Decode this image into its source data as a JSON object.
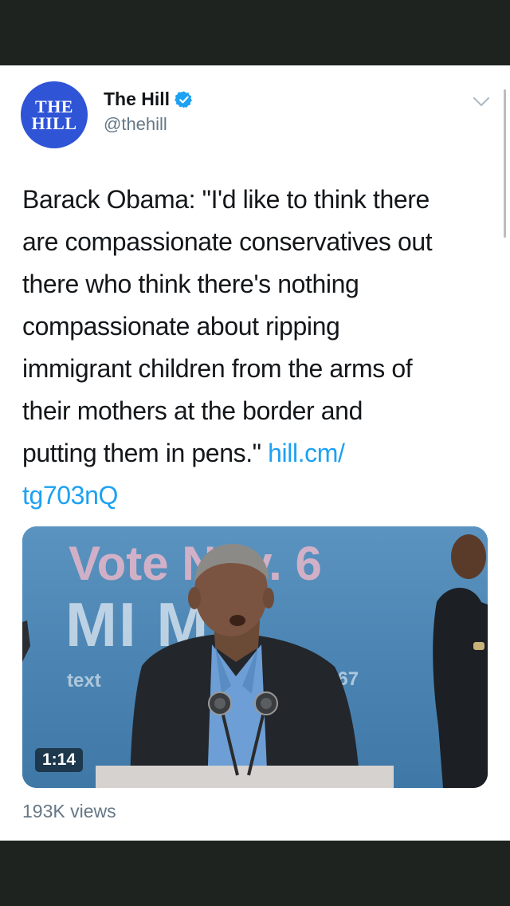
{
  "tweet": {
    "avatar_text": [
      "THE",
      "HILL"
    ],
    "display_name": "The Hill",
    "handle": "@thehill",
    "verified": true,
    "text_lines": [
      "Barack Obama: \"I'd like to think there",
      "are compassionate conservatives out",
      "there who think there's nothing",
      "compassionate about ripping",
      "immigrant children from the arms of",
      "their mothers at the border and",
      "putting them in pens.\" "
    ],
    "link_part1": "hill.cm/",
    "link_part2": "tg703nQ",
    "link_color": "#1da1f2",
    "brand_color": "#2f54d6"
  },
  "video": {
    "sign_line1": "Vote  Nov. 6",
    "sign_line2": "MI   MS",
    "sign_small_left": "text",
    "sign_small_right": "367",
    "duration": "1:14"
  },
  "stats": {
    "views": "193K views"
  },
  "icons": {
    "verified": "verified-badge-icon",
    "chevron": "chevron-down-icon"
  }
}
